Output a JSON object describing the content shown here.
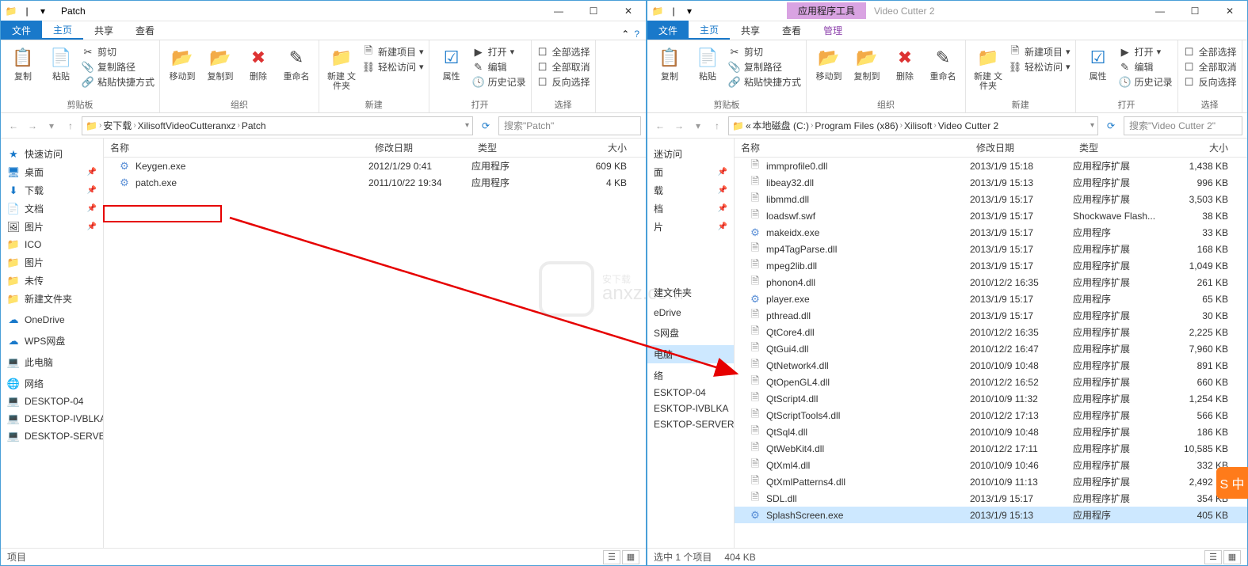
{
  "left": {
    "title": "Patch",
    "tabs": {
      "file": "文件",
      "home": "主页",
      "share": "共享",
      "view": "查看"
    },
    "ribbon": {
      "clipboard": {
        "label": "剪贴板",
        "copy": "复制",
        "paste": "粘贴",
        "cut": "剪切",
        "copy_path": "复制路径",
        "paste_shortcut": "粘贴快捷方式"
      },
      "organize": {
        "label": "组织",
        "move_to": "移动到",
        "copy_to": "复制到",
        "delete": "删除",
        "rename": "重命名"
      },
      "new": {
        "label": "新建",
        "new_folder": "新建\n文件夹",
        "new_item": "新建项目",
        "easy_access": "轻松访问"
      },
      "open": {
        "label": "打开",
        "properties": "属性",
        "open_btn": "打开",
        "edit": "编辑",
        "history": "历史记录"
      },
      "select": {
        "label": "选择",
        "select_all": "全部选择",
        "select_none": "全部取消",
        "invert": "反向选择"
      }
    },
    "breadcrumbs": [
      "安下载",
      "XilisoftVideoCutteranxz",
      "Patch"
    ],
    "search_placeholder": "搜索\"Patch\"",
    "columns": {
      "name": "名称",
      "date": "修改日期",
      "type": "类型",
      "size": "大小"
    },
    "nav": {
      "quick": "快速访问",
      "desktop": "桌面",
      "downloads": "下载",
      "documents": "文档",
      "pictures": "图片",
      "ico": "ICO",
      "pictures2": "图片",
      "untransferred": "未传",
      "new_folder": "新建文件夹",
      "onedrive": "OneDrive",
      "wps": "WPS网盘",
      "this_pc": "此电脑",
      "network": "网络",
      "d04": "DESKTOP-04",
      "divblka": "DESKTOP-IVBLKA",
      "dserver": "DESKTOP-SERVER"
    },
    "files": [
      {
        "name": "Keygen.exe",
        "date": "2012/1/29 0:41",
        "type": "应用程序",
        "size": "609 KB",
        "icon": "exe"
      },
      {
        "name": "patch.exe",
        "date": "2011/10/22 19:34",
        "type": "应用程序",
        "size": "4 KB",
        "icon": "exe"
      }
    ],
    "status": "项目"
  },
  "right": {
    "context_tab": "应用程序工具",
    "title": "Video Cutter 2",
    "tabs": {
      "file": "文件",
      "home": "主页",
      "share": "共享",
      "view": "查看",
      "manage": "管理"
    },
    "ribbon": {
      "clipboard": {
        "label": "剪贴板",
        "copy": "复制",
        "paste": "粘贴",
        "cut": "剪切",
        "copy_path": "复制路径",
        "paste_shortcut": "粘贴快捷方式"
      },
      "organize": {
        "label": "组织",
        "move_to": "移动到",
        "copy_to": "复制到",
        "delete": "删除",
        "rename": "重命名"
      },
      "new": {
        "label": "新建",
        "new_folder": "新建\n文件夹",
        "new_item": "新建项目",
        "easy_access": "轻松访问"
      },
      "open": {
        "label": "打开",
        "properties": "属性",
        "open_btn": "打开",
        "edit": "编辑",
        "history": "历史记录"
      },
      "select": {
        "label": "选择",
        "select_all": "全部选择",
        "select_none": "全部取消",
        "invert": "反向选择"
      }
    },
    "breadcrumbs_prefix": "«",
    "breadcrumbs": [
      "本地磁盘 (C:)",
      "Program Files (x86)",
      "Xilisoft",
      "Video Cutter 2"
    ],
    "search_placeholder": "搜索\"Video Cutter 2\"",
    "columns": {
      "name": "名称",
      "date": "修改日期",
      "type": "类型",
      "size": "大小"
    },
    "nav": {
      "quick": "迷访问",
      "desktop": "面",
      "downloads": "载",
      "documents": "档",
      "pictures": "片",
      "new_folder": "建文件夹",
      "onedrive": "eDrive",
      "wps": "S网盘",
      "this_pc": "电脑",
      "network": "络",
      "d04": "ESKTOP-04",
      "divblka": "ESKTOP-IVBLKA",
      "dserver": "ESKTOP-SERVER"
    },
    "files": [
      {
        "name": "immprofile0.dll",
        "date": "2013/1/9 15:18",
        "type": "应用程序扩展",
        "size": "1,438 KB",
        "icon": "dll"
      },
      {
        "name": "libeay32.dll",
        "date": "2013/1/9 15:13",
        "type": "应用程序扩展",
        "size": "996 KB",
        "icon": "dll"
      },
      {
        "name": "libmmd.dll",
        "date": "2013/1/9 15:17",
        "type": "应用程序扩展",
        "size": "3,503 KB",
        "icon": "dll"
      },
      {
        "name": "loadswf.swf",
        "date": "2013/1/9 15:17",
        "type": "Shockwave Flash...",
        "size": "38 KB",
        "icon": "dll"
      },
      {
        "name": "makeidx.exe",
        "date": "2013/1/9 15:17",
        "type": "应用程序",
        "size": "33 KB",
        "icon": "exe"
      },
      {
        "name": "mp4TagParse.dll",
        "date": "2013/1/9 15:17",
        "type": "应用程序扩展",
        "size": "168 KB",
        "icon": "dll"
      },
      {
        "name": "mpeg2lib.dll",
        "date": "2013/1/9 15:17",
        "type": "应用程序扩展",
        "size": "1,049 KB",
        "icon": "dll"
      },
      {
        "name": "phonon4.dll",
        "date": "2010/12/2 16:35",
        "type": "应用程序扩展",
        "size": "261 KB",
        "icon": "dll"
      },
      {
        "name": "player.exe",
        "date": "2013/1/9 15:17",
        "type": "应用程序",
        "size": "65 KB",
        "icon": "exe"
      },
      {
        "name": "pthread.dll",
        "date": "2013/1/9 15:17",
        "type": "应用程序扩展",
        "size": "30 KB",
        "icon": "dll"
      },
      {
        "name": "QtCore4.dll",
        "date": "2010/12/2 16:35",
        "type": "应用程序扩展",
        "size": "2,225 KB",
        "icon": "dll"
      },
      {
        "name": "QtGui4.dll",
        "date": "2010/12/2 16:47",
        "type": "应用程序扩展",
        "size": "7,960 KB",
        "icon": "dll"
      },
      {
        "name": "QtNetwork4.dll",
        "date": "2010/10/9 10:48",
        "type": "应用程序扩展",
        "size": "891 KB",
        "icon": "dll"
      },
      {
        "name": "QtOpenGL4.dll",
        "date": "2010/12/2 16:52",
        "type": "应用程序扩展",
        "size": "660 KB",
        "icon": "dll"
      },
      {
        "name": "QtScript4.dll",
        "date": "2010/10/9 11:32",
        "type": "应用程序扩展",
        "size": "1,254 KB",
        "icon": "dll"
      },
      {
        "name": "QtScriptTools4.dll",
        "date": "2010/12/2 17:13",
        "type": "应用程序扩展",
        "size": "566 KB",
        "icon": "dll"
      },
      {
        "name": "QtSql4.dll",
        "date": "2010/10/9 10:48",
        "type": "应用程序扩展",
        "size": "186 KB",
        "icon": "dll"
      },
      {
        "name": "QtWebKit4.dll",
        "date": "2010/12/2 17:11",
        "type": "应用程序扩展",
        "size": "10,585 KB",
        "icon": "dll"
      },
      {
        "name": "QtXml4.dll",
        "date": "2010/10/9 10:46",
        "type": "应用程序扩展",
        "size": "332 KB",
        "icon": "dll"
      },
      {
        "name": "QtXmlPatterns4.dll",
        "date": "2010/10/9 11:13",
        "type": "应用程序扩展",
        "size": "2,492 KB",
        "icon": "dll"
      },
      {
        "name": "SDL.dll",
        "date": "2013/1/9 15:17",
        "type": "应用程序扩展",
        "size": "354 KB",
        "icon": "dll"
      },
      {
        "name": "SplashScreen.exe",
        "date": "2013/1/9 15:13",
        "type": "应用程序",
        "size": "405 KB",
        "icon": "exe",
        "selected": true
      }
    ],
    "status_items": "选中 1 个项目",
    "status_size": "404 KB"
  },
  "watermark": "安下载\nanxz.com"
}
